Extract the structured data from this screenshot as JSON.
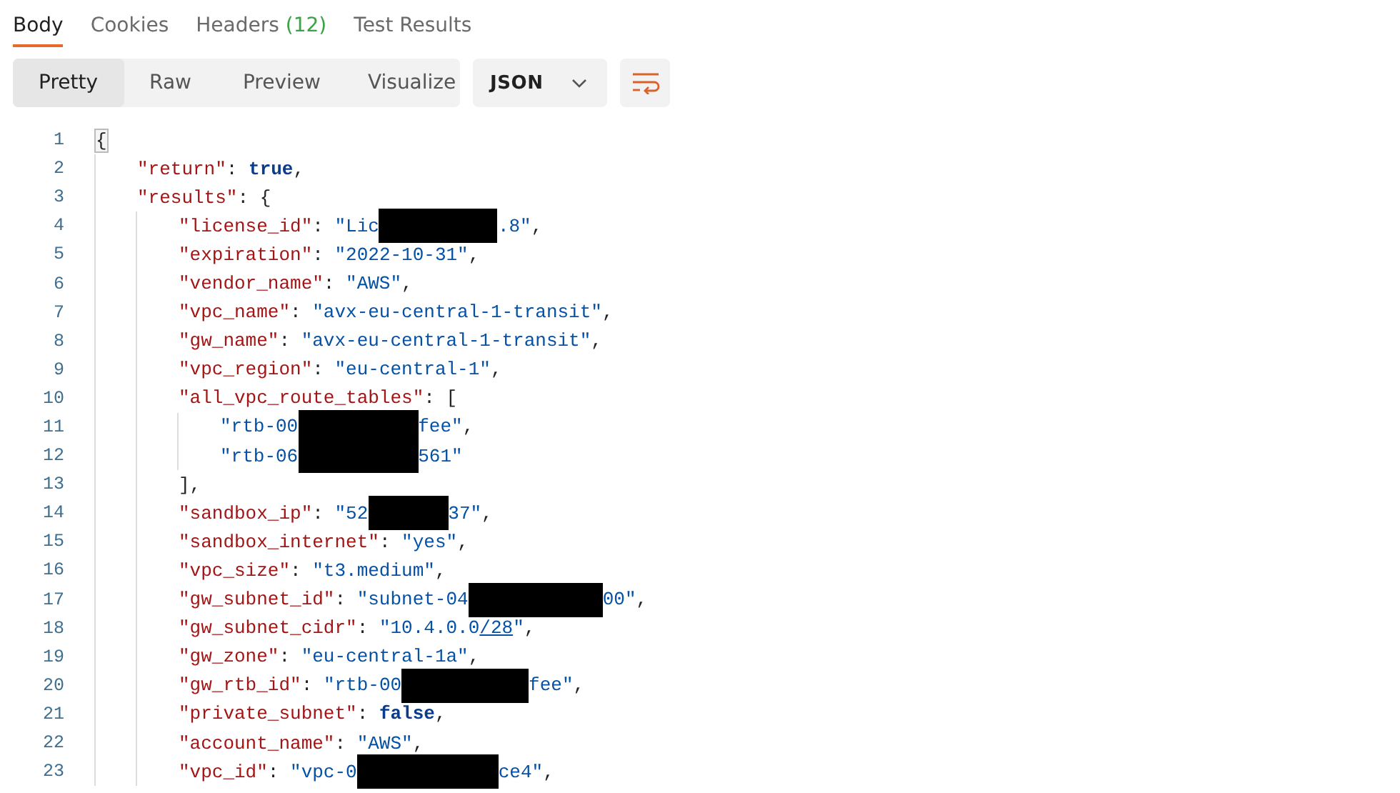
{
  "tabs": [
    {
      "label": "Body",
      "selected": true
    },
    {
      "label": "Cookies",
      "selected": false
    },
    {
      "label": "Headers",
      "count": "(12)",
      "selected": false
    },
    {
      "label": "Test Results",
      "selected": false
    }
  ],
  "view_modes": [
    {
      "label": "Pretty",
      "selected": true
    },
    {
      "label": "Raw",
      "selected": false
    },
    {
      "label": "Preview",
      "selected": false
    },
    {
      "label": "Visualize",
      "selected": false
    }
  ],
  "format_dropdown": {
    "value": "JSON"
  },
  "code": [
    {
      "number": "1",
      "segments": [
        {
          "kind": "bracket",
          "text": "{"
        }
      ],
      "children": [
        {
          "number": "2",
          "segments": [
            {
              "kind": "key",
              "text": "\"return\""
            },
            {
              "kind": "punct",
              "text": ": "
            },
            {
              "kind": "literal",
              "text": "true"
            },
            {
              "kind": "punct",
              "text": ","
            }
          ]
        },
        {
          "number": "3",
          "segments": [
            {
              "kind": "key",
              "text": "\"results\""
            },
            {
              "kind": "punct",
              "text": ": {"
            }
          ],
          "children": [
            {
              "number": "4",
              "segments": [
                {
                  "kind": "key",
                  "text": "\"license_id\""
                },
                {
                  "kind": "punct",
                  "text": ": "
                },
                {
                  "kind": "string",
                  "text": "\"Lic"
                },
                {
                  "kind": "redacted"
                },
                {
                  "kind": "string",
                  "text": ".8\""
                },
                {
                  "kind": "punct",
                  "text": ","
                }
              ]
            },
            {
              "number": "5",
              "segments": [
                {
                  "kind": "key",
                  "text": "\"expiration\""
                },
                {
                  "kind": "punct",
                  "text": ": "
                },
                {
                  "kind": "string",
                  "text": "\"2022-10-31\""
                },
                {
                  "kind": "punct",
                  "text": ","
                }
              ]
            },
            {
              "number": "6",
              "segments": [
                {
                  "kind": "key",
                  "text": "\"vendor_name\""
                },
                {
                  "kind": "punct",
                  "text": ": "
                },
                {
                  "kind": "string",
                  "text": "\"AWS\""
                },
                {
                  "kind": "punct",
                  "text": ","
                }
              ]
            },
            {
              "number": "7",
              "segments": [
                {
                  "kind": "key",
                  "text": "\"vpc_name\""
                },
                {
                  "kind": "punct",
                  "text": ": "
                },
                {
                  "kind": "string",
                  "text": "\"avx-eu-central-1-transit\""
                },
                {
                  "kind": "punct",
                  "text": ","
                }
              ]
            },
            {
              "number": "8",
              "segments": [
                {
                  "kind": "key",
                  "text": "\"gw_name\""
                },
                {
                  "kind": "punct",
                  "text": ": "
                },
                {
                  "kind": "string",
                  "text": "\"avx-eu-central-1-transit\""
                },
                {
                  "kind": "punct",
                  "text": ","
                }
              ]
            },
            {
              "number": "9",
              "segments": [
                {
                  "kind": "key",
                  "text": "\"vpc_region\""
                },
                {
                  "kind": "punct",
                  "text": ": "
                },
                {
                  "kind": "string",
                  "text": "\"eu-central-1\""
                },
                {
                  "kind": "punct",
                  "text": ","
                }
              ]
            },
            {
              "number": "10",
              "segments": [
                {
                  "kind": "key",
                  "text": "\"all_vpc_route_tables\""
                },
                {
                  "kind": "punct",
                  "text": ": ["
                }
              ],
              "children": [
                {
                  "number": "11",
                  "segments": [
                    {
                      "kind": "string",
                      "text": "\"rtb-00"
                    },
                    {
                      "kind": "redacted"
                    },
                    {
                      "kind": "string",
                      "text": "fee\""
                    },
                    {
                      "kind": "punct",
                      "text": ","
                    }
                  ]
                },
                {
                  "number": "12",
                  "segments": [
                    {
                      "kind": "string",
                      "text": "\"rtb-06"
                    },
                    {
                      "kind": "redacted"
                    },
                    {
                      "kind": "string",
                      "text": "561\""
                    }
                  ]
                }
              ]
            },
            {
              "number": "13",
              "segments": [
                {
                  "kind": "punct",
                  "text": "],"
                }
              ]
            },
            {
              "number": "14",
              "segments": [
                {
                  "kind": "key",
                  "text": "\"sandbox_ip\""
                },
                {
                  "kind": "punct",
                  "text": ": "
                },
                {
                  "kind": "string",
                  "text": "\"52"
                },
                {
                  "kind": "redacted"
                },
                {
                  "kind": "string",
                  "text": "37\""
                },
                {
                  "kind": "punct",
                  "text": ","
                }
              ]
            },
            {
              "number": "15",
              "segments": [
                {
                  "kind": "key",
                  "text": "\"sandbox_internet\""
                },
                {
                  "kind": "punct",
                  "text": ": "
                },
                {
                  "kind": "string",
                  "text": "\"yes\""
                },
                {
                  "kind": "punct",
                  "text": ","
                }
              ]
            },
            {
              "number": "16",
              "segments": [
                {
                  "kind": "key",
                  "text": "\"vpc_size\""
                },
                {
                  "kind": "punct",
                  "text": ": "
                },
                {
                  "kind": "string",
                  "text": "\"t3.medium\""
                },
                {
                  "kind": "punct",
                  "text": ","
                }
              ]
            },
            {
              "number": "17",
              "segments": [
                {
                  "kind": "key",
                  "text": "\"gw_subnet_id\""
                },
                {
                  "kind": "punct",
                  "text": ": "
                },
                {
                  "kind": "string",
                  "text": "\"subnet-04"
                },
                {
                  "kind": "redacted"
                },
                {
                  "kind": "string",
                  "text": "00\""
                },
                {
                  "kind": "punct",
                  "text": ","
                }
              ]
            },
            {
              "number": "18",
              "segments": [
                {
                  "kind": "key",
                  "text": "\"gw_subnet_cidr\""
                },
                {
                  "kind": "punct",
                  "text": ": "
                },
                {
                  "kind": "string",
                  "text": "\"10.4.0.0"
                },
                {
                  "kind": "link",
                  "text": "/28"
                },
                {
                  "kind": "string",
                  "text": "\""
                },
                {
                  "kind": "punct",
                  "text": ","
                }
              ]
            },
            {
              "number": "19",
              "segments": [
                {
                  "kind": "key",
                  "text": "\"gw_zone\""
                },
                {
                  "kind": "punct",
                  "text": ": "
                },
                {
                  "kind": "string",
                  "text": "\"eu-central-1a\""
                },
                {
                  "kind": "punct",
                  "text": ","
                }
              ]
            },
            {
              "number": "20",
              "segments": [
                {
                  "kind": "key",
                  "text": "\"gw_rtb_id\""
                },
                {
                  "kind": "punct",
                  "text": ": "
                },
                {
                  "kind": "string",
                  "text": "\"rtb-00"
                },
                {
                  "kind": "redacted"
                },
                {
                  "kind": "string",
                  "text": "fee\""
                },
                {
                  "kind": "punct",
                  "text": ","
                }
              ]
            },
            {
              "number": "21",
              "segments": [
                {
                  "kind": "key",
                  "text": "\"private_subnet\""
                },
                {
                  "kind": "punct",
                  "text": ": "
                },
                {
                  "kind": "literal",
                  "text": "false"
                },
                {
                  "kind": "punct",
                  "text": ","
                }
              ]
            },
            {
              "number": "22",
              "segments": [
                {
                  "kind": "key",
                  "text": "\"account_name\""
                },
                {
                  "kind": "punct",
                  "text": ": "
                },
                {
                  "kind": "string",
                  "text": "\"AWS\""
                },
                {
                  "kind": "punct",
                  "text": ","
                }
              ]
            },
            {
              "number": "23",
              "segments": [
                {
                  "kind": "key",
                  "text": "\"vpc_id\""
                },
                {
                  "kind": "punct",
                  "text": ": "
                },
                {
                  "kind": "string",
                  "text": "\"vpc-0"
                },
                {
                  "kind": "redacted"
                },
                {
                  "kind": "string",
                  "text": "ce4\""
                },
                {
                  "kind": "punct",
                  "text": ","
                }
              ]
            }
          ]
        }
      ]
    }
  ]
}
